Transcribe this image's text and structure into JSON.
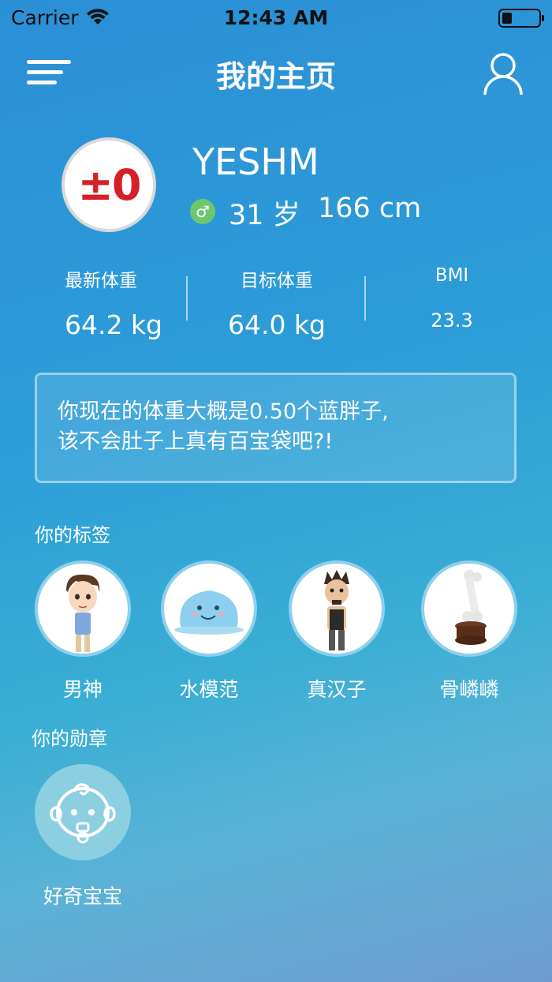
{
  "status_bar": {
    "carrier": "Carrier",
    "time": "12:43 AM"
  },
  "header": {
    "title": "我的主页",
    "menu_icon": "menu-icon",
    "profile_icon": "user-icon"
  },
  "profile": {
    "avatar_text": "±0",
    "username": "YESHM",
    "gender_symbol": "♂",
    "age": "31 岁",
    "height": "166 cm"
  },
  "stats": [
    {
      "label": "最新体重",
      "value": "64.2 kg"
    },
    {
      "label": "目标体重",
      "value": "64.0 kg"
    },
    {
      "label": "BMI",
      "value": "23.3"
    }
  ],
  "message": {
    "line1": "你现在的体重大概是0.50个蓝胖子,",
    "line2": "该不会肚子上真有百宝袋吧?!"
  },
  "tags_section": {
    "label": "你的标签",
    "tags": [
      {
        "name": "男神"
      },
      {
        "name": "水模范"
      },
      {
        "name": "真汉子"
      },
      {
        "name": "骨嶙嶙"
      }
    ]
  },
  "medals_section": {
    "label": "你的勋章",
    "medals": [
      {
        "name": "好奇宝宝"
      }
    ]
  },
  "colors": {
    "accent_red": "#d71f26",
    "gender_green": "#6dc76d",
    "medal_bg": "#8ccfe0"
  }
}
